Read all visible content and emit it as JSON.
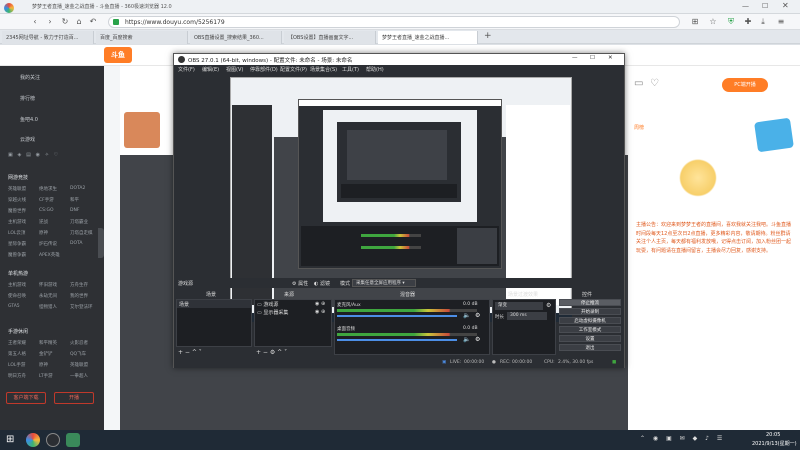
{
  "browser": {
    "title": "梦梦王者直播_速金之战直播 - 斗鱼直播 - 360极速浏览器 12.0",
    "url": "https://www.douyu.com/5256179",
    "tabs": [
      {
        "label": "2345网址导航 - 致力于打造百..."
      },
      {
        "label": "百度_百度搜索"
      },
      {
        "label": "OBS直播设置_搜索结果_360..."
      },
      {
        "label": "【OBS设置】直播画面文字..."
      },
      {
        "label": "梦梦王者直播_速金之战直播..."
      }
    ]
  },
  "sidebar": {
    "items": [
      {
        "label": "我的关注"
      },
      {
        "label": "排行榜"
      },
      {
        "label": "鱼吧4.0"
      },
      {
        "label": "云游戏"
      }
    ],
    "section1": "网游竞技",
    "grid1": [
      "英雄联盟",
      "绝地求生",
      "DOTA2",
      "穿越火线",
      "CF手游",
      "和平",
      "魔兽世界",
      "CS:GO",
      "DNF",
      "主机游戏",
      "逆战",
      "刀塔霸业",
      "LOL云顶",
      "原神",
      "刀塔自走棋",
      "星际争霸",
      "炉石传说",
      "DOTA",
      "魔兽争霸",
      "APEX英雄"
    ],
    "section2": "单机热游",
    "grid2": [
      "主机游戏",
      "怀旧游戏",
      "方舟生存",
      "使命召唤",
      "永劫无间",
      "我的世界",
      "GTA5",
      "怪物猎人",
      "艾尔登法环"
    ],
    "section3": "手游休闲",
    "grid3": [
      "王者荣耀",
      "和平精英",
      "火影忍者",
      "第五人格",
      "金铲铲",
      "QQ飞车",
      "LOL手游",
      "原神",
      "英雄联盟",
      "明日方舟",
      "LT手游",
      "一拳超人"
    ],
    "btn_left": "客户端下载",
    "btn_right": "开播"
  },
  "obs": {
    "title": "OBS 27.0.1 (64-bit, windows) - 配置文件: 未命名 - 场景: 未命名",
    "menu": [
      "文件(F)",
      "编辑(E)",
      "视图(V)",
      "停靠部件(D)",
      "配置文件(P)",
      "场景集合(S)",
      "工具(T)",
      "帮助(H)"
    ],
    "source_toolbar": {
      "props": "属性",
      "filter": "滤镜",
      "mode_label": "模式",
      "mode_value": "采集任意全屏应用程序"
    },
    "docks": {
      "scenes": "场景",
      "sources": "来源",
      "mixer": "混音器",
      "transitions": "场景过渡效果",
      "controls": "控件"
    },
    "scene_items": [
      "场景"
    ],
    "source_items": [
      "游戏源",
      "显示器采集"
    ],
    "mixer_tracks": [
      {
        "name": "麦克风/Aux",
        "db": "0.0 dB",
        "level": 0.55
      },
      {
        "name": "桌面音频",
        "db": "0.0 dB",
        "level": 0.62
      }
    ],
    "transition": {
      "type": "渐变",
      "duration_label": "时长",
      "duration": "300 ms"
    },
    "controls": [
      "停止推流",
      "开始录制",
      "启动虚拟摄像机",
      "工作室模式",
      "设置",
      "退出"
    ],
    "status": {
      "live_label": "LIVE:",
      "live": "00:00:00",
      "rec_label": "REC:",
      "rec": "00:00:00",
      "cpu_label": "CPU:",
      "cpu": "2.4%, 30.00 fps"
    }
  },
  "right_panel": {
    "announce": "主播公告：欢迎来到梦梦王者的直播间，喜欢我就关注我吧。斗鱼直播时间段每天12点至次日2点直播，更多精彩内容，敬请期待。粉丝群请关注个人主页，每天都有福利发放哦，记得点击订阅，加入粉丝团一起玩耍，有问题请在直播间留言，主播会尽力回复，感谢支持。",
    "open_btn": "PC端开播",
    "tab_weekly": "周榜"
  },
  "taskbar": {
    "time": "20:05",
    "date": "2021/9/13(星期一)"
  }
}
